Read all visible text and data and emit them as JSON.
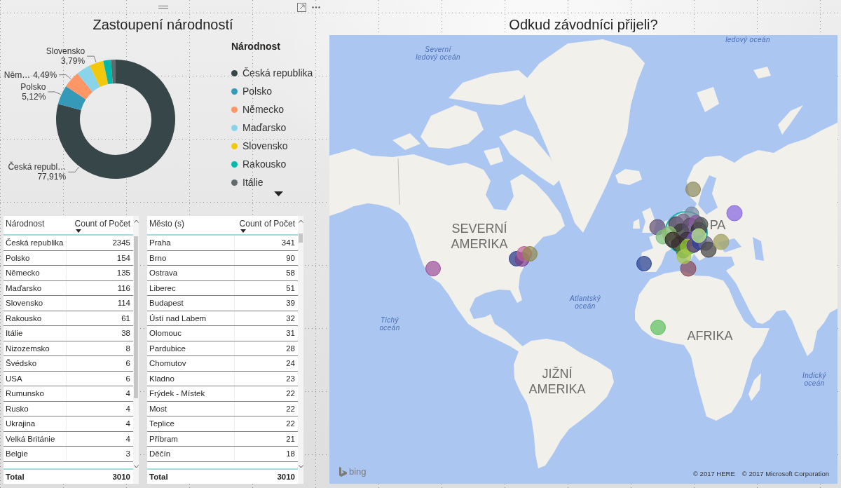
{
  "donut_visual": {
    "chart_data": {
      "type": "donut",
      "title": "Zastoupení národností",
      "categories": [
        "Česká republika",
        "Polsko",
        "Německo",
        "Maďarsko",
        "Slovensko",
        "Rakousko",
        "Itálie"
      ],
      "values": [
        77.91,
        5.12,
        4.49,
        3.85,
        3.79,
        2.03,
        1.26
      ]
    },
    "slice_labels": [
      {
        "name": "Slovensko",
        "value": "3,79%",
        "kind": "stacked"
      },
      {
        "name": "Něm…",
        "value": "4,49%",
        "kind": "inline"
      },
      {
        "name": "Polsko",
        "value": "5,12%",
        "kind": "stacked"
      },
      {
        "name": "Česká republ…",
        "value": "77,91%",
        "kind": "stacked"
      }
    ],
    "legend": {
      "title": "Národnost",
      "items": [
        {
          "color": "#374649"
        },
        {
          "color": "#3599b8"
        },
        {
          "color": "#fe9666"
        },
        {
          "color": "#8ad4eb"
        },
        {
          "color": "#f2c80f"
        },
        {
          "color": "#01b8aa"
        },
        {
          "color": "#5f6b6d"
        }
      ]
    }
  },
  "tables": [
    {
      "columns": [
        {
          "label": "Národnost",
          "sorted": false
        },
        {
          "label": "Count of Počet",
          "sorted": true
        }
      ],
      "rows": [
        [
          "Česká republika",
          "2345"
        ],
        [
          "Polsko",
          "154"
        ],
        [
          "Německo",
          "135"
        ],
        [
          "Maďarsko",
          "116"
        ],
        [
          "Slovensko",
          "114"
        ],
        [
          "Rakousko",
          "61"
        ],
        [
          "Itálie",
          "38"
        ],
        [
          "Nizozemsko",
          "8"
        ],
        [
          "Švédsko",
          "6"
        ],
        [
          "USA",
          "6"
        ],
        [
          "Rumunsko",
          "4"
        ],
        [
          "Rusko",
          "4"
        ],
        [
          "Ukrajina",
          "4"
        ],
        [
          "Velká Británie",
          "4"
        ],
        [
          "Belgie",
          "3"
        ]
      ],
      "total": [
        "Total",
        "3010"
      ]
    },
    {
      "columns": [
        {
          "label": "Město (s)",
          "sorted": false
        },
        {
          "label": "Count of Počet",
          "sorted": true
        }
      ],
      "rows": [
        [
          "Praha",
          "341"
        ],
        [
          "Brno",
          "90"
        ],
        [
          "Ostrava",
          "58"
        ],
        [
          "Liberec",
          "51"
        ],
        [
          "Budapest",
          "39"
        ],
        [
          "Ústí nad Labem",
          "32"
        ],
        [
          "Olomouc",
          "31"
        ],
        [
          "Pardubice",
          "28"
        ],
        [
          "Chomutov",
          "24"
        ],
        [
          "Kladno",
          "23"
        ],
        [
          "Frýdek - Místek",
          "22"
        ],
        [
          "Most",
          "22"
        ],
        [
          "Teplice",
          "22"
        ],
        [
          "Příbram",
          "21"
        ],
        [
          "Děčín",
          "18"
        ]
      ],
      "total": [
        "Total",
        "3010"
      ]
    }
  ],
  "map_visual": {
    "title": "Odkud závodníci přijeli?",
    "labels": [
      {
        "kind": "ocean",
        "lines": [
          "Severní",
          "ledový oceán"
        ]
      },
      {
        "kind": "ocean",
        "lines": [
          "ledový oceán"
        ]
      },
      {
        "kind": "continent",
        "lines": [
          "SEVERNÍ",
          "AMERIKA"
        ]
      },
      {
        "kind": "continent",
        "lines": [
          "PA"
        ]
      },
      {
        "kind": "ocean",
        "lines": [
          "Atlantský",
          "oceán"
        ]
      },
      {
        "kind": "ocean",
        "lines": [
          "Tichý",
          "oceán"
        ]
      },
      {
        "kind": "continent",
        "lines": [
          "AFRIKA"
        ]
      },
      {
        "kind": "continent",
        "lines": [
          "JIŽNÍ",
          "AMERIKA"
        ]
      },
      {
        "kind": "ocean",
        "lines": [
          "Indický",
          "oceán"
        ]
      }
    ],
    "logo_text": "bing",
    "attribution": [
      "© 2017 HERE",
      "© 2017 Microsoft Corporation"
    ]
  }
}
